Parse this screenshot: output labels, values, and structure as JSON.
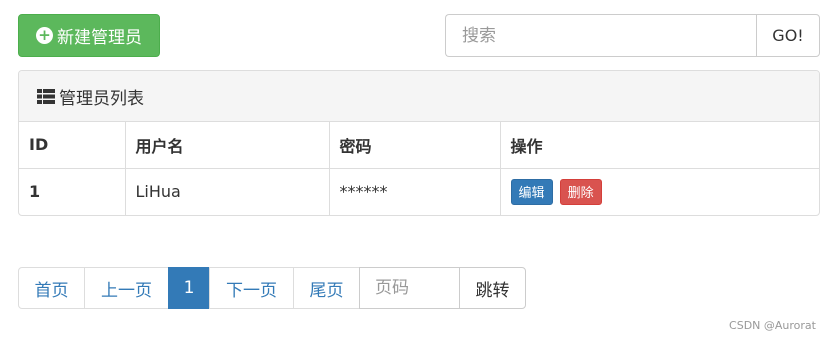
{
  "toolbar": {
    "new_admin_label": "新建管理员",
    "new_admin_icon": "plus-circle-icon"
  },
  "search": {
    "placeholder": "搜索",
    "value": "",
    "button_label": "GO!"
  },
  "panel": {
    "title": "管理员列表",
    "title_icon": "list-icon"
  },
  "table": {
    "headers": [
      "ID",
      "用户名",
      "密码",
      "操作"
    ],
    "rows": [
      {
        "id": "1",
        "username": "LiHua",
        "password": "******",
        "actions": {
          "edit": "编辑",
          "delete": "删除"
        }
      }
    ]
  },
  "pagination": {
    "first": "首页",
    "prev": "上一页",
    "current": "1",
    "next": "下一页",
    "last": "尾页",
    "page_input_placeholder": "页码",
    "jump": "跳转"
  },
  "watermark": "CSDN @Aurorat",
  "colors": {
    "success": "#5cb85c",
    "primary": "#337ab7",
    "danger": "#d9534f",
    "panel_bg": "#f5f5f5",
    "border": "#dddddd"
  }
}
